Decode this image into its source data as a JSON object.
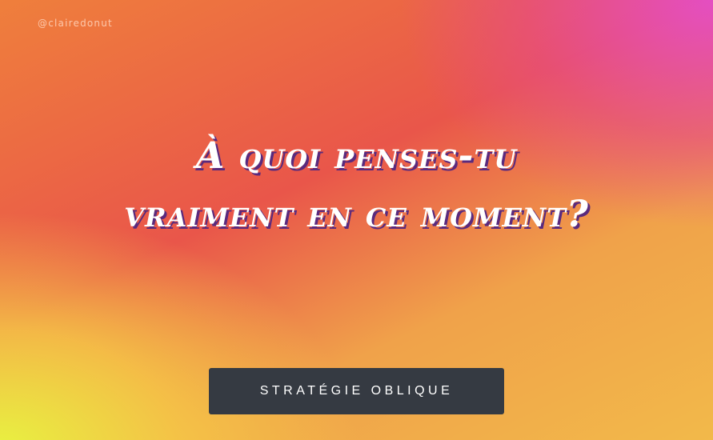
{
  "header": {
    "handle": "@clairedonut"
  },
  "card": {
    "prompt": "À quoi penses-tu vraiment en ce moment?"
  },
  "actions": {
    "oblique_button_label": "STRATÉGIE OBLIQUE"
  },
  "colors": {
    "gradient_top_left": "#ef7f3c",
    "gradient_center": "#e9564a",
    "gradient_top_right": "#e44ec8",
    "gradient_bottom_left": "#e8f740",
    "button_background": "#353a42",
    "text": "#ffffff",
    "text_shadow": "#5a2a7d"
  }
}
